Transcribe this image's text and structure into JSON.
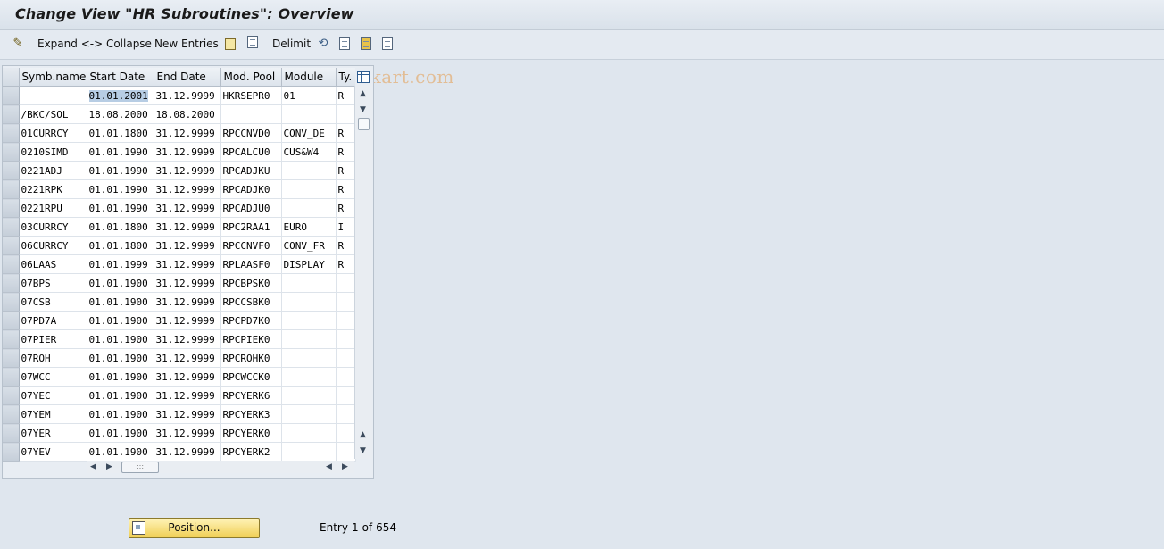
{
  "window": {
    "title": "Change View \"HR Subroutines\": Overview"
  },
  "toolbar": {
    "expand_collapse": "Expand <-> Collapse",
    "new_entries": "New Entries",
    "delimit": "Delimit",
    "watermark": "www.tutorialkart.com"
  },
  "table": {
    "columns": [
      "Symb.name",
      "Start Date",
      "End Date",
      "Mod. Pool",
      "Module",
      "Ty."
    ],
    "rows": [
      [
        "",
        "01.01.2001",
        "31.12.9999",
        "HKRSEPR0",
        "01",
        "R"
      ],
      [
        "/BKC/SOL",
        "18.08.2000",
        "18.08.2000",
        "",
        "",
        ""
      ],
      [
        "01CURRCY",
        "01.01.1800",
        "31.12.9999",
        "RPCCNVD0",
        "CONV_DE",
        "R"
      ],
      [
        "0210SIMD",
        "01.01.1990",
        "31.12.9999",
        "RPCALCU0",
        "CUS&W4",
        "R"
      ],
      [
        "0221ADJ",
        "01.01.1990",
        "31.12.9999",
        "RPCADJKU",
        "",
        "R"
      ],
      [
        "0221RPK",
        "01.01.1990",
        "31.12.9999",
        "RPCADJK0",
        "",
        "R"
      ],
      [
        "0221RPU",
        "01.01.1990",
        "31.12.9999",
        "RPCADJU0",
        "",
        "R"
      ],
      [
        "03CURRCY",
        "01.01.1800",
        "31.12.9999",
        "RPC2RAA1",
        "EURO",
        "I"
      ],
      [
        "06CURRCY",
        "01.01.1800",
        "31.12.9999",
        "RPCCNVF0",
        "CONV_FR",
        "R"
      ],
      [
        "06LAAS",
        "01.01.1999",
        "31.12.9999",
        "RPLAASF0",
        "DISPLAY",
        "R"
      ],
      [
        "07BPS",
        "01.01.1900",
        "31.12.9999",
        "RPCBPSK0",
        "",
        ""
      ],
      [
        "07CSB",
        "01.01.1900",
        "31.12.9999",
        "RPCCSBK0",
        "",
        ""
      ],
      [
        "07PD7A",
        "01.01.1900",
        "31.12.9999",
        "RPCPD7K0",
        "",
        ""
      ],
      [
        "07PIER",
        "01.01.1900",
        "31.12.9999",
        "RPCPIEK0",
        "",
        ""
      ],
      [
        "07ROH",
        "01.01.1900",
        "31.12.9999",
        "RPCROHK0",
        "",
        ""
      ],
      [
        "07WCC",
        "01.01.1900",
        "31.12.9999",
        "RPCWCCK0",
        "",
        ""
      ],
      [
        "07YEC",
        "01.01.1900",
        "31.12.9999",
        "RPCYERK6",
        "",
        ""
      ],
      [
        "07YEM",
        "01.01.1900",
        "31.12.9999",
        "RPCYERK3",
        "",
        ""
      ],
      [
        "07YER",
        "01.01.1900",
        "31.12.9999",
        "RPCYERK0",
        "",
        ""
      ],
      [
        "07YEV",
        "01.01.1900",
        "31.12.9999",
        "RPCYERK2",
        "",
        ""
      ]
    ]
  },
  "footer": {
    "position_button": "Position...",
    "entry_label": "Entry",
    "entry_current": "1",
    "entry_of": "of",
    "entry_total": "654"
  }
}
